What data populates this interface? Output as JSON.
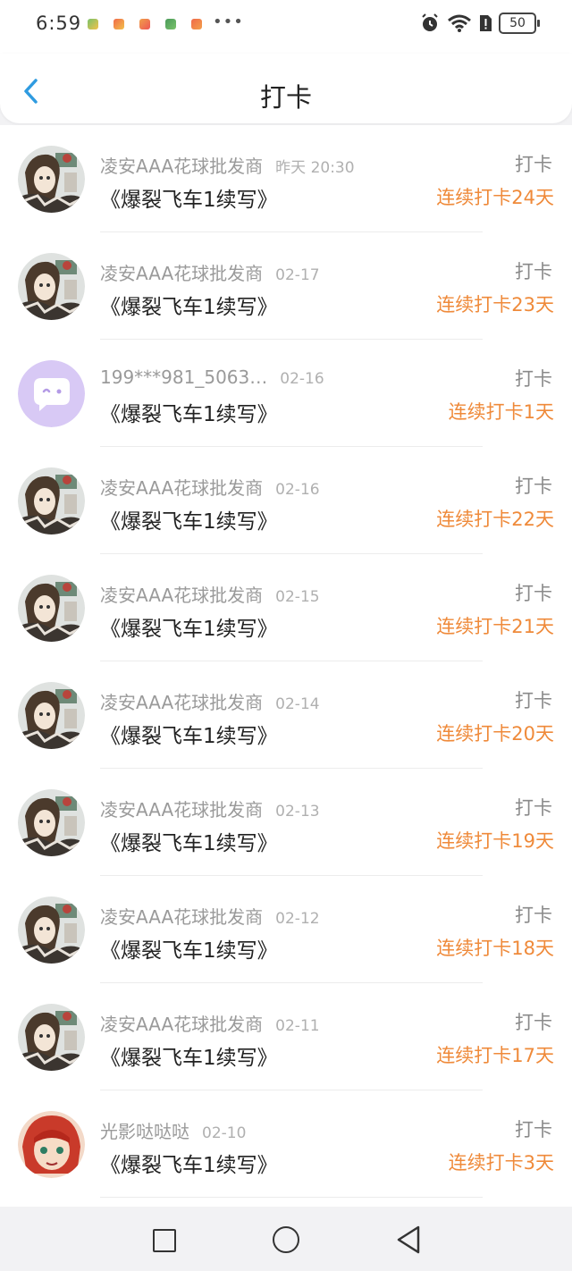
{
  "status_bar": {
    "time": "6:59",
    "more": "•••",
    "battery": "50"
  },
  "header": {
    "title": "打卡"
  },
  "entries": [
    {
      "user": "凌安AAA花球批发商",
      "date": "昨天 20:30",
      "book": "《爆裂飞车1续写》",
      "action": "打卡",
      "streak": "连续打卡24天",
      "avatar": "anime-girl"
    },
    {
      "user": "凌安AAA花球批发商",
      "date": "02-17",
      "book": "《爆裂飞车1续写》",
      "action": "打卡",
      "streak": "连续打卡23天",
      "avatar": "anime-girl"
    },
    {
      "user": "199***981_5063…",
      "date": "02-16",
      "book": "《爆裂飞车1续写》",
      "action": "打卡",
      "streak": "连续打卡1天",
      "avatar": "default-chat"
    },
    {
      "user": "凌安AAA花球批发商",
      "date": "02-16",
      "book": "《爆裂飞车1续写》",
      "action": "打卡",
      "streak": "连续打卡22天",
      "avatar": "anime-girl"
    },
    {
      "user": "凌安AAA花球批发商",
      "date": "02-15",
      "book": "《爆裂飞车1续写》",
      "action": "打卡",
      "streak": "连续打卡21天",
      "avatar": "anime-girl"
    },
    {
      "user": "凌安AAA花球批发商",
      "date": "02-14",
      "book": "《爆裂飞车1续写》",
      "action": "打卡",
      "streak": "连续打卡20天",
      "avatar": "anime-girl"
    },
    {
      "user": "凌安AAA花球批发商",
      "date": "02-13",
      "book": "《爆裂飞车1续写》",
      "action": "打卡",
      "streak": "连续打卡19天",
      "avatar": "anime-girl"
    },
    {
      "user": "凌安AAA花球批发商",
      "date": "02-12",
      "book": "《爆裂飞车1续写》",
      "action": "打卡",
      "streak": "连续打卡18天",
      "avatar": "anime-girl"
    },
    {
      "user": "凌安AAA花球批发商",
      "date": "02-11",
      "book": "《爆裂飞车1续写》",
      "action": "打卡",
      "streak": "连续打卡17天",
      "avatar": "anime-girl"
    },
    {
      "user": "光影哒哒哒",
      "date": "02-10",
      "book": "《爆裂飞车1续写》",
      "action": "打卡",
      "streak": "连续打卡3天",
      "avatar": "red-hair-girl"
    }
  ],
  "colors": {
    "accent": "#2f9be0",
    "streak": "#ef8a3a",
    "default_avatar_bg": "#d8c9f5"
  },
  "icons": {
    "back": "chevron-left-icon",
    "alarm": "alarm-icon",
    "wifi": "wifi-icon",
    "sim": "sim-alert-icon",
    "nav_recents": "square-icon",
    "nav_home": "circle-icon",
    "nav_back": "triangle-back-icon"
  }
}
